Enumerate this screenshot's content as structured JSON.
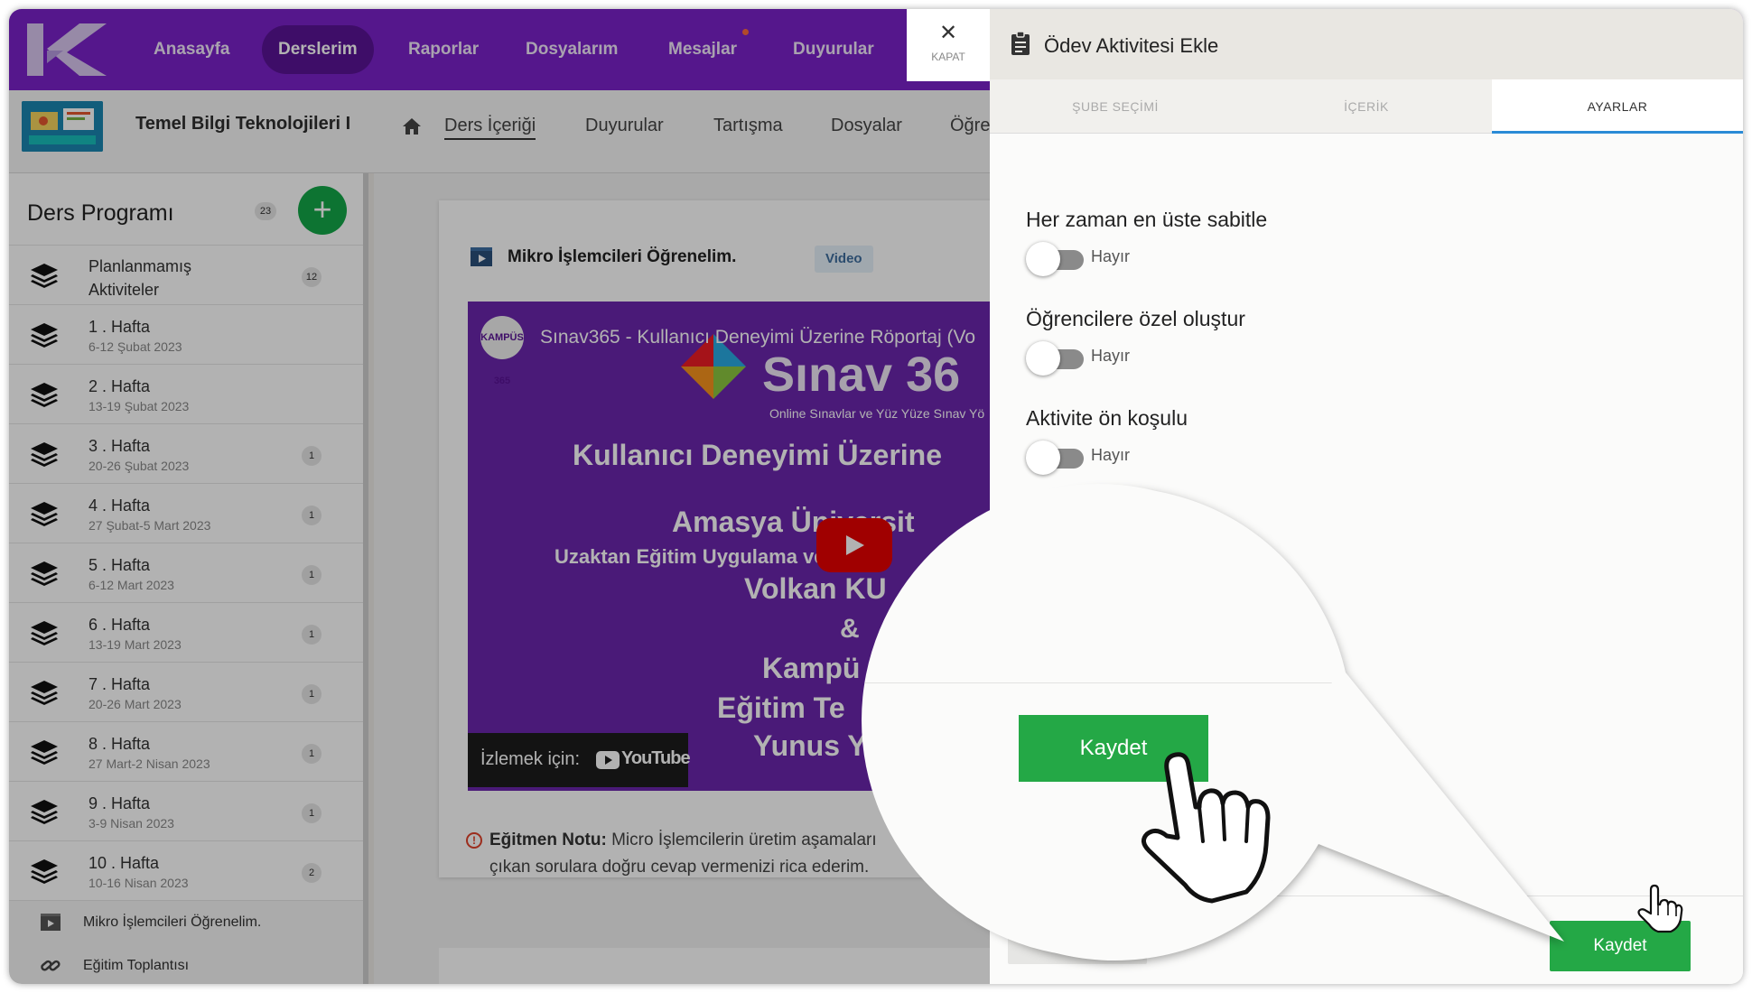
{
  "topnav": {
    "items": [
      "Anasayfa",
      "Derslerim",
      "Raporlar",
      "Dosyalarım",
      "Mesajlar",
      "Duyurular"
    ],
    "active": "Derslerim"
  },
  "course": {
    "title": "Temel Bilgi Teknolojileri I",
    "tabs": [
      "Ders İçeriği",
      "Duyurular",
      "Tartışma",
      "Dosyalar",
      "Öğre"
    ]
  },
  "sidebar": {
    "title": "Ders Programı",
    "count": "23",
    "add_icon": "plus-icon",
    "unscheduled": {
      "label": "Planlanmamış Aktiviteler",
      "count": "12"
    },
    "weeks": [
      {
        "name": "1 . Hafta",
        "date": "6-12 Şubat 2023",
        "count": ""
      },
      {
        "name": "2 . Hafta",
        "date": "13-19 Şubat 2023",
        "count": ""
      },
      {
        "name": "3 . Hafta",
        "date": "20-26 Şubat 2023",
        "count": "1"
      },
      {
        "name": "4 . Hafta",
        "date": "27 Şubat-5 Mart 2023",
        "count": "1"
      },
      {
        "name": "5 . Hafta",
        "date": "6-12 Mart 2023",
        "count": "1"
      },
      {
        "name": "6 . Hafta",
        "date": "13-19 Mart 2023",
        "count": "1"
      },
      {
        "name": "7 . Hafta",
        "date": "20-26 Mart 2023",
        "count": "1"
      },
      {
        "name": "8 . Hafta",
        "date": "27 Mart-2 Nisan 2023",
        "count": "1"
      },
      {
        "name": "9 . Hafta",
        "date": "3-9 Nisan 2023",
        "count": "1"
      },
      {
        "name": "10 . Hafta",
        "date": "10-16 Nisan 2023",
        "count": "2"
      }
    ],
    "subitems": [
      {
        "label": "Mikro İşlemcileri Öğrenelim.",
        "icon": "video-icon"
      },
      {
        "label": "Eğitim Toplantısı",
        "icon": "link-icon"
      }
    ]
  },
  "content": {
    "card_title": "Mikro İşlemcileri Öğrenelim.",
    "badge": "Video",
    "video": {
      "channel_avatar": "KAMPÜS 365",
      "title": "Sınav365 - Kullanıcı Deneyimi Üzerine Röportaj (Vo",
      "brand": "Sınav 36",
      "brand_sub": "Online Sınavlar ve Yüz Yüze Sınav Yö",
      "lines": [
        "Kullanıcı Deneyimi Üzerine",
        "Amasya Üniversit",
        "Uzaktan Eğitim Uygulama ve Araşt",
        "Volkan KU",
        "&",
        "Kampü",
        "Eğitim Te",
        "Yunus Y"
      ],
      "watch_label": "İzlemek için:",
      "youtube": "YouTube"
    },
    "note_label": "Eğitmen Notu:",
    "note_line1": "Micro İşlemcilerin üretim aşamaları",
    "note_line2": "çıkan sorulara doğru cevap vermenizi rica ederim."
  },
  "close": {
    "icon": "close-icon",
    "label": "KAPAT"
  },
  "drawer": {
    "title": "Ödev Aktivitesi Ekle",
    "tabs": [
      "ŞUBE SEÇİMİ",
      "İÇERİK",
      "AYARLAR"
    ],
    "active_tab": "AYARLAR",
    "settings": [
      {
        "label": "Her zaman en üste sabitle",
        "value": "Hayır",
        "on": false
      },
      {
        "label": "Öğrencilere özel oluştur",
        "value": "Hayır",
        "on": false
      },
      {
        "label": "Aktivite ön koşulu",
        "value": "Hayır",
        "on": false
      }
    ],
    "save_label": "Kaydet",
    "magnified_save_label": "Kaydet"
  },
  "colors": {
    "nav_purple": "#7a22c9",
    "nav_active": "#5a1496",
    "green": "#24a846",
    "tab_underline": "#2a8bd6"
  }
}
